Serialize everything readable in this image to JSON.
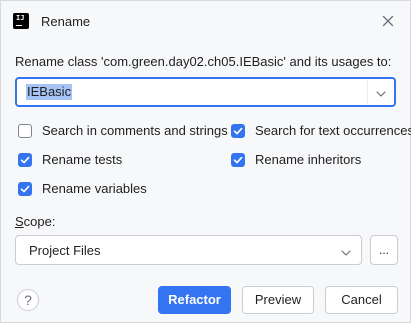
{
  "window": {
    "title": "Rename",
    "icon": "intellij-app-icon",
    "icon_glyph": "IJ"
  },
  "prompt": "Rename class 'com.green.day02.ch05.IEBasic' and its usages to:",
  "name_field": {
    "value": "IEBasic",
    "selected": true
  },
  "options": {
    "search_comments": {
      "label": "Search in comments and strings",
      "checked": false
    },
    "search_text": {
      "label": "Search for text occurrences",
      "checked": true
    },
    "rename_tests": {
      "label": "Rename tests",
      "checked": true
    },
    "rename_inheritors": {
      "label": "Rename inheritors",
      "checked": true
    },
    "rename_variables": {
      "label": "Rename variables",
      "checked": true
    }
  },
  "scope": {
    "label_mnemonic": "S",
    "label_rest": "cope:",
    "value": "Project Files",
    "more_label": "..."
  },
  "buttons": {
    "help": "?",
    "refactor": "Refactor",
    "preview": "Preview",
    "cancel": "Cancel"
  },
  "colors": {
    "accent": "#3574f0",
    "selection": "#a6c3f6",
    "background": "#f7f8fa"
  }
}
